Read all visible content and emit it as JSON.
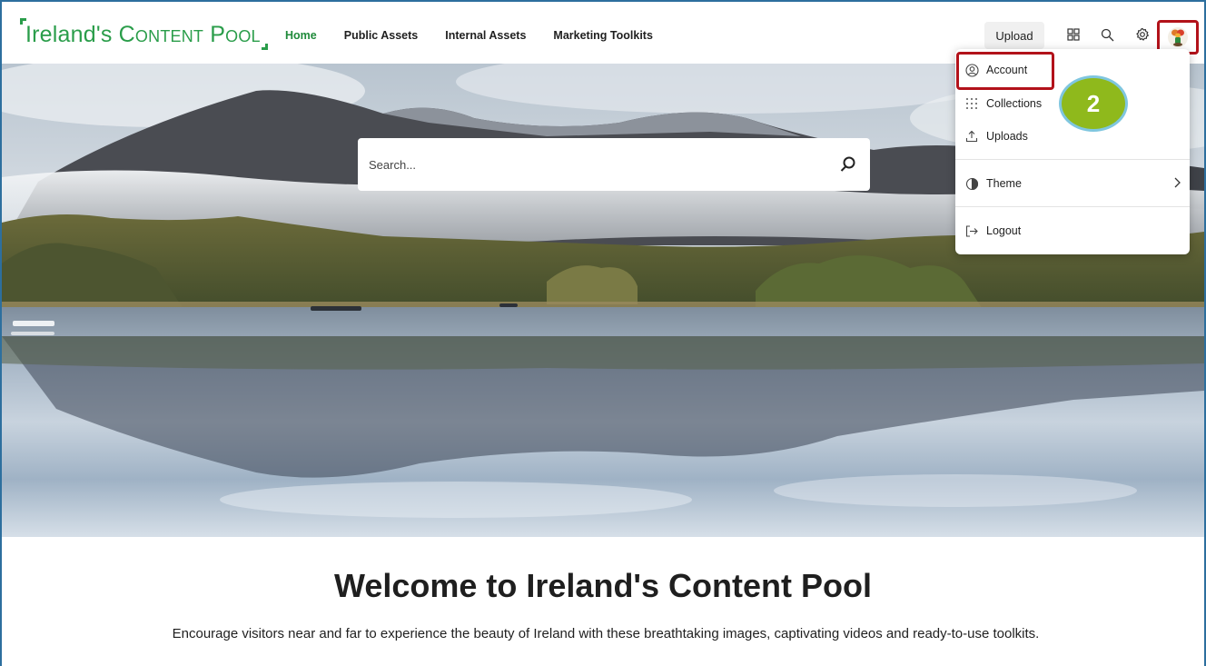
{
  "header": {
    "logo_main": "Ireland's",
    "logo_sc": "Content Pool",
    "nav": [
      "Home",
      "Public Assets",
      "Internal Assets",
      "Marketing Toolkits"
    ],
    "upload_label": "Upload",
    "icons": [
      "grid-icon",
      "search-icon",
      "gear-icon",
      "avatar"
    ]
  },
  "search": {
    "placeholder": "Search..."
  },
  "menu": {
    "items": [
      {
        "label": "Account",
        "icon": "user-circle-icon"
      },
      {
        "label": "Collections",
        "icon": "dots-grid-icon"
      },
      {
        "label": "Uploads",
        "icon": "upload-icon"
      },
      {
        "label": "Theme",
        "icon": "theme-icon"
      },
      {
        "label": "Logout",
        "icon": "logout-icon"
      }
    ]
  },
  "step_badge": "2",
  "welcome": {
    "title": "Welcome to Ireland's Content Pool",
    "subtitle": "Encourage visitors near and far to experience the beauty of Ireland with these breathtaking images, captivating videos and ready-to-use toolkits."
  },
  "colors": {
    "brand_green": "#2a9d4a",
    "highlight_red": "#b2121a",
    "badge_green": "#8fb91c"
  }
}
